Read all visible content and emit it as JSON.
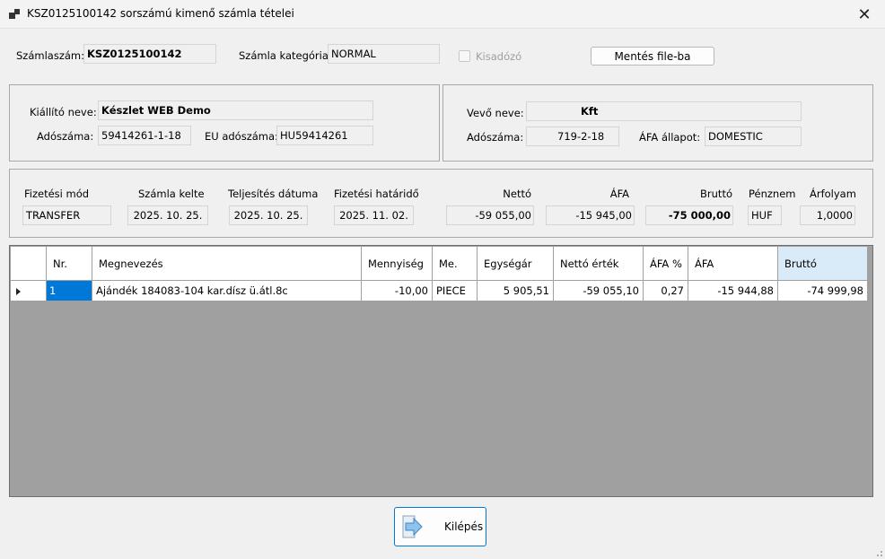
{
  "window": {
    "title": "KSZ0125100142 sorszámú kimenő számla tételei"
  },
  "top": {
    "invoice_number_label": "Számlaszám:",
    "invoice_number": "KSZ0125100142",
    "category_label": "Számla kategória:",
    "category": "NORMAL",
    "small_taxpayer_label": "Kisadózó",
    "save_button": "Mentés file-ba"
  },
  "issuer": {
    "name_label": "Kiállító neve:",
    "name": "Készlet WEB Demo",
    "tax_label": "Adószáma:",
    "tax_number": "59414261-1-18",
    "eu_tax_label": "EU adószáma:",
    "eu_tax_number": "HU59414261"
  },
  "buyer": {
    "name_label": "Vevő neve:",
    "name": "Kft",
    "tax_label": "Adószáma:",
    "tax_number": "719-2-18",
    "vat_status_label": "ÁFA állapot:",
    "vat_status": "DOMESTIC"
  },
  "summary": {
    "payment_method_label": "Fizetési mód",
    "payment_method": "TRANSFER",
    "invoice_date_label": "Számla kelte",
    "invoice_date": "2025. 10. 25.",
    "fulfillment_date_label": "Teljesítés dátuma",
    "fulfillment_date": "2025. 10. 25.",
    "due_date_label": "Fizetési határidő",
    "due_date": "2025. 11. 02.",
    "net_label": "Nettó",
    "net": "-59 055,00",
    "vat_label": "ÁFA",
    "vat": "-15 945,00",
    "gross_label": "Bruttó",
    "gross": "-75 000,00",
    "currency_label": "Pénznem",
    "currency": "HUF",
    "rate_label": "Árfolyam",
    "rate": "1,0000"
  },
  "grid": {
    "columns": [
      "Nr.",
      "Megnevezés",
      "Mennyiség",
      "Me.",
      "Egységár",
      "Nettó érték",
      "ÁFA %",
      "ÁFA",
      "Bruttó"
    ],
    "rows": [
      [
        "1",
        "Ajándék 184083-104 kar.dísz ü.átl.8c",
        "-10,00",
        "PIECE",
        "5 905,51",
        "-59 055,10",
        "0,27",
        "-15 944,88",
        "-74 999,98"
      ]
    ]
  },
  "footer": {
    "exit_button": "Kilépés"
  },
  "colors": {
    "accent": "#0078d7",
    "grid_background": "#a0a0a0",
    "selected_header": "#d9ebf9"
  }
}
